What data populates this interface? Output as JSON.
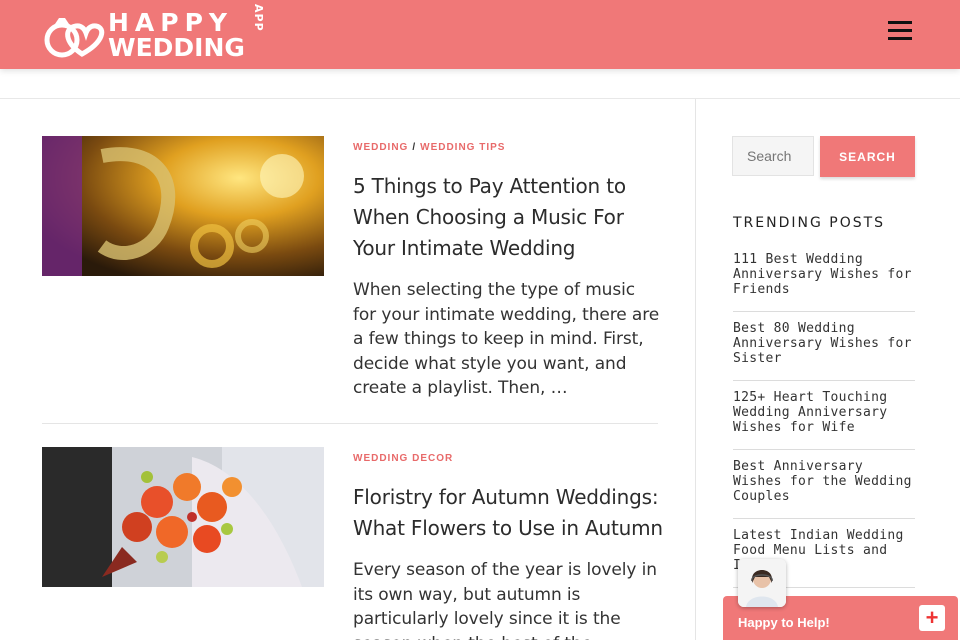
{
  "header": {
    "logo": {
      "line1": "HAPPY",
      "line2": "WEDDING",
      "suffix": "APP"
    },
    "menu_icon": "hamburger-menu-icon",
    "color": "#f07878"
  },
  "posts": [
    {
      "categories": [
        "WEDDING",
        "WEDDING TIPS"
      ],
      "separator": "/",
      "title": "5 Things to Pay Attention to When Choosing a Music For Your Intimate Wedding",
      "excerpt": "When selecting the type of music for your intimate wedding, there are a few things to keep in mind.  First, decide what style you want, and create a playlist.  Then, …"
    },
    {
      "categories": [
        "WEDDING DECOR"
      ],
      "title": "Floristry for Autumn Weddings: What Flowers to Use in Autumn",
      "excerpt": "Every season of the year is lovely in its own way, but autumn is particularly lovely since it is the season when the best of the"
    }
  ],
  "sidebar": {
    "search_placeholder": "Search",
    "search_button": "SEARCH",
    "trending_title": "TRENDING POSTS",
    "trending": [
      "111 Best Wedding Anniversary Wishes for Friends",
      "Best 80 Wedding Anniversary Wishes for Sister",
      "125+ Heart Touching Wedding Anniversary Wishes for Wife",
      "Best Anniversary Wishes for the Wedding Couples",
      "Latest Indian Wedding Food Menu Lists and Ideas"
    ]
  },
  "help_widget": {
    "label": "Happy to Help!",
    "plus": "+"
  },
  "colors": {
    "accent": "#f07878",
    "category": "#e86a6a"
  }
}
